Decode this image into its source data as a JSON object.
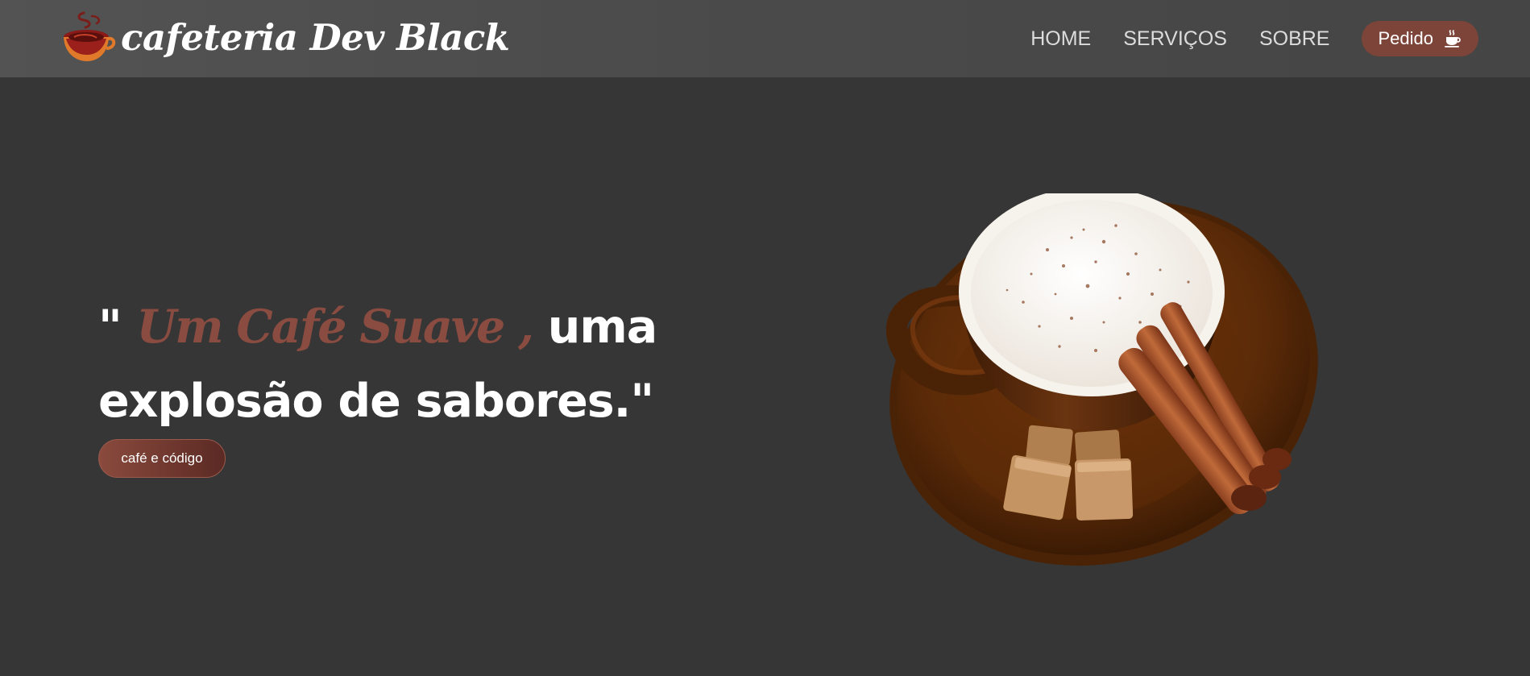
{
  "brand": {
    "name": "cafeteria Dev Black",
    "logo_icon": "coffee-cup-logo-icon"
  },
  "nav": {
    "items": [
      "HOME",
      "SERVIÇOS",
      "SOBRE"
    ],
    "order_button": "Pedido",
    "order_icon": "coffee-cup-icon"
  },
  "hero": {
    "quote_open": "\" ",
    "highlight": "Um Café Suave ,",
    "rest": " uma explosão de sabores.\"",
    "button": "café e código",
    "image": "coffee-cup-with-cinnamon-and-sugar"
  },
  "colors": {
    "background": "#363636",
    "header": "#4c4c4c",
    "accent": "#7d453a",
    "highlight_text": "#8a4c40"
  }
}
